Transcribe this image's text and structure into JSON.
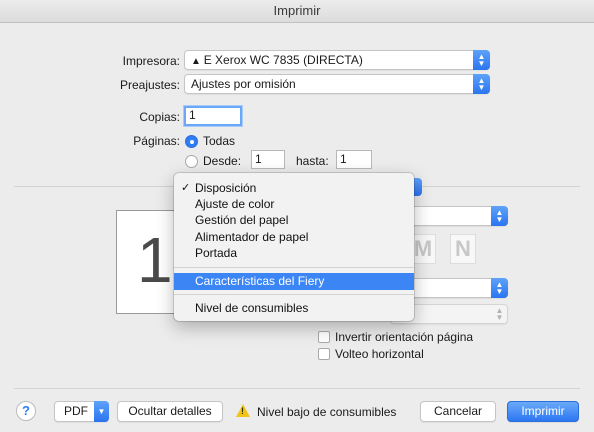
{
  "window": {
    "title": "Imprimir"
  },
  "printer": {
    "label": "Impresora:",
    "value": "E Xerox WC 7835 (DIRECTA)"
  },
  "presets": {
    "label": "Preajustes:",
    "value": "Ajustes por omisión"
  },
  "copies": {
    "label": "Copias:",
    "value": "1"
  },
  "pages": {
    "label": "Páginas:",
    "all_label": "Todas",
    "from_label": "Desde:",
    "from_value": "1",
    "to_label": "hasta:",
    "to_value": "1"
  },
  "preview": {
    "page_number": "1"
  },
  "menu": {
    "items": [
      {
        "label": "Disposición",
        "checked": true
      },
      {
        "label": "Ajuste de color"
      },
      {
        "label": "Gestión del papel"
      },
      {
        "label": "Alimentador de papel"
      },
      {
        "label": "Portada"
      },
      {
        "label": "Características del Fiery",
        "selected": true
      },
      {
        "label": "Nivel de consumibles"
      }
    ],
    "check_glyph": "✓"
  },
  "options": {
    "invert_orientation": "Invertir orientación página",
    "flip_horizontal": "Volteo horizontal"
  },
  "footer": {
    "help": "?",
    "pdf": "PDF",
    "hide_details": "Ocultar detalles",
    "warning_icon": "!",
    "warning": "Nivel bajo de consumibles",
    "cancel": "Cancelar",
    "print": "Imprimir"
  },
  "colors": {
    "accent": "#2f7cf6",
    "menu_highlight": "#3c85f5",
    "warning": "#f0c419"
  }
}
